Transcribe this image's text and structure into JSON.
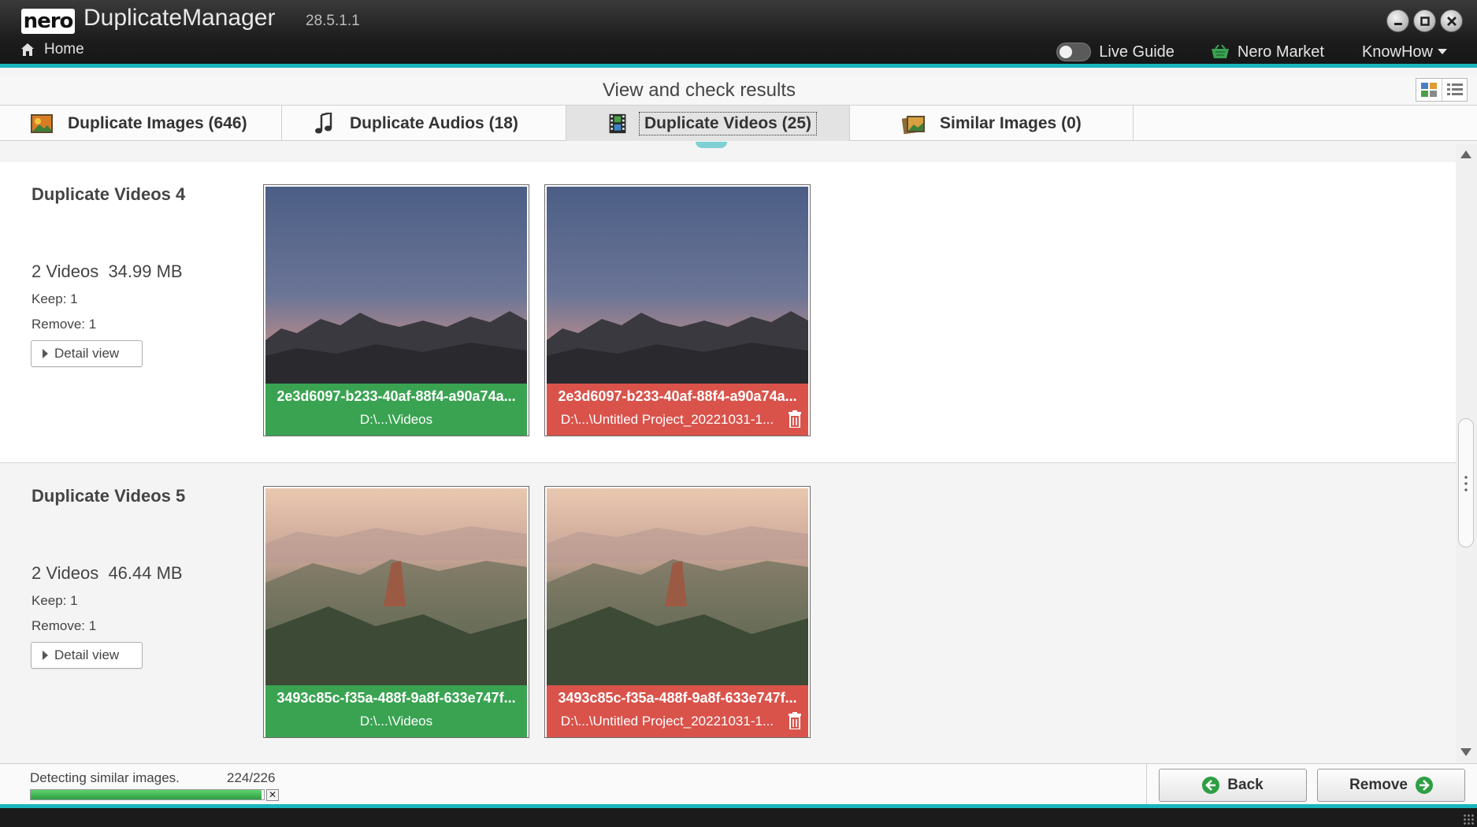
{
  "app": {
    "logo": "nero",
    "title": "DuplicateManager",
    "version": "28.5.1.1",
    "home_label": "Home"
  },
  "topnav": {
    "live_guide": "Live Guide",
    "nero_market": "Nero Market",
    "knowhow": "KnowHow"
  },
  "header": {
    "title": "View and check results"
  },
  "tabs": [
    {
      "label": "Duplicate Images (646)",
      "icon": "images-icon"
    },
    {
      "label": "Duplicate Audios (18)",
      "icon": "music-note-icon"
    },
    {
      "label": "Duplicate Videos (25)",
      "icon": "film-icon",
      "active": true
    },
    {
      "label": "Similar Images (0)",
      "icon": "similar-images-icon"
    }
  ],
  "groups": [
    {
      "title": "Duplicate Videos 4",
      "summary": "2 Videos  34.99 MB",
      "keep": "Keep: 1",
      "remove": "Remove: 1",
      "detail_label": "Detail view",
      "items": [
        {
          "name": "2e3d6097-b233-40af-88f4-a90a74a...",
          "path": "D:\\...\\Videos",
          "status": "keep"
        },
        {
          "name": "2e3d6097-b233-40af-88f4-a90a74a...",
          "path": "D:\\...\\Untitled Project_20221031-1...",
          "status": "remove"
        }
      ]
    },
    {
      "title": "Duplicate Videos 5",
      "summary": "2 Videos  46.44 MB",
      "keep": "Keep: 1",
      "remove": "Remove: 1",
      "detail_label": "Detail view",
      "items": [
        {
          "name": "3493c85c-f35a-488f-9a8f-633e747f...",
          "path": "D:\\...\\Videos",
          "status": "keep"
        },
        {
          "name": "3493c85c-f35a-488f-9a8f-633e747f...",
          "path": "D:\\...\\Untitled Project_20221031-1...",
          "status": "remove"
        }
      ]
    }
  ],
  "footer": {
    "status": "Detecting similar images.",
    "count": "224/226",
    "progress": 0.991,
    "back_label": "Back",
    "remove_label": "Remove"
  },
  "colors": {
    "accent": "#19b6bd",
    "keep": "#3aa352",
    "remove": "#d9534b"
  }
}
